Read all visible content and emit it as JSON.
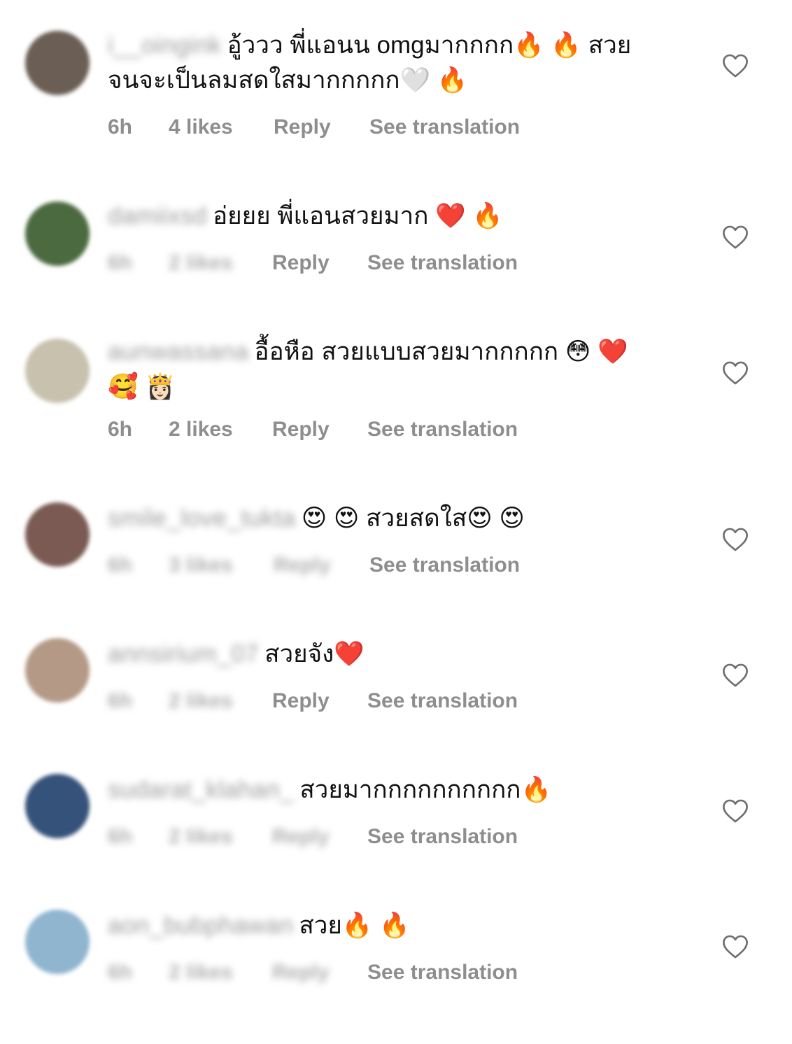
{
  "comments": [
    {
      "username": "i__oingink",
      "line1": "อู้ววว พี่แอนน omgมากกกก🔥 🔥 สวย",
      "line2": "จนจะเป็นลมสดใสมากกกกก🤍 🔥",
      "time": "6h",
      "likes": "4 likes",
      "reply": "Reply",
      "translation": "See translation",
      "avatar_color": "#6b5f55",
      "meta_blurred": false
    },
    {
      "username": "damiixsd",
      "line1": "อ่ยยย พี่แอนสวยมาก ❤️ 🔥",
      "line2": "",
      "time": "6h",
      "likes": "2 likes",
      "reply": "Reply",
      "translation": "See translation",
      "avatar_color": "#4b6a3f",
      "meta_blurred": true
    },
    {
      "username": "aunwassana",
      "line1": "อื้อหือ สวยแบบสวยมากกกกก 😳 ❤️",
      "line2": "🥰 👸🏻",
      "time": "6h",
      "likes": "2 likes",
      "reply": "Reply",
      "translation": "See translation",
      "avatar_color": "#c7c1ad",
      "meta_blurred": false
    },
    {
      "username": "smile_love_tukta",
      "line1": "😍 😍 สวยสดใส😍 😍",
      "line2": "",
      "time": "6h",
      "likes": "3 likes",
      "reply": "Reply",
      "translation": "See translation",
      "avatar_color": "#7a5a52",
      "meta_blurred": true
    },
    {
      "username": "annsirium_07",
      "line1": "สวยจัง❤️",
      "line2": "",
      "time": "6h",
      "likes": "2 likes",
      "reply": "Reply",
      "translation": "See translation",
      "avatar_color": "#b49a86",
      "meta_blurred": true
    },
    {
      "username": "sudarat_klahan_",
      "line1": "สวยมากกกกกกกกกก🔥",
      "line2": "",
      "time": "6h",
      "likes": "2 likes",
      "reply": "Reply",
      "translation": "See translation",
      "avatar_color": "#35527a",
      "meta_blurred": true
    },
    {
      "username": "aon_bubphawan",
      "line1": "สวย🔥 🔥",
      "line2": "",
      "time": "6h",
      "likes": "2 likes",
      "reply": "Reply",
      "translation": "See translation",
      "avatar_color": "#8fb5cf",
      "meta_blurred": true
    }
  ]
}
